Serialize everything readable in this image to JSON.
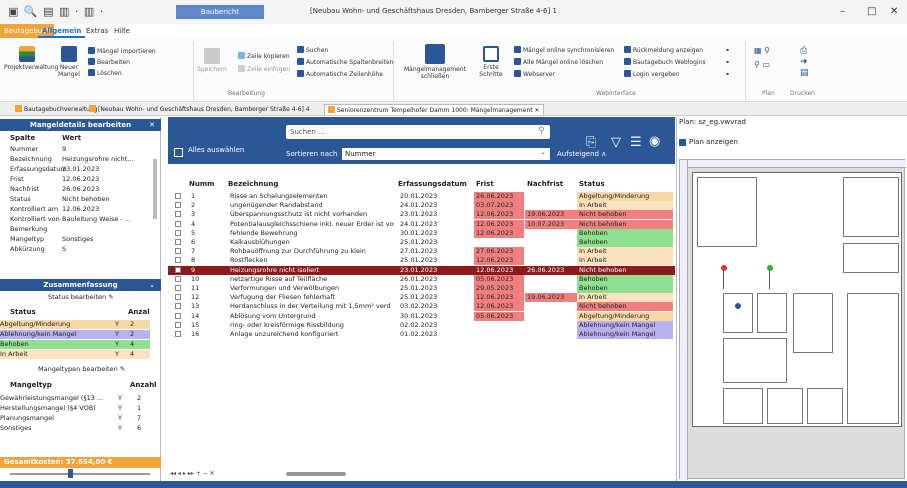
{
  "app": {
    "context_tab": "Baubericht",
    "window_title": "[Neubau Wohn- und Geschäftshaus Dresden, Bamberger Straße 4-6] 1",
    "window_controls": [
      "–",
      "□",
      "✕"
    ]
  },
  "ribbon_tabs": [
    "Bautagebuch",
    "Allgemein",
    "Extras",
    "Hilfe"
  ],
  "ribbon": {
    "projektverwaltung": "Projektverwaltung",
    "neuer_mangel": "Neuer Mangel",
    "maengel_importieren": "Mängel importieren",
    "bearbeiten": "Bearbeiten",
    "loeschen": "Löschen",
    "speichern": "Speichern",
    "zeile_kopieren": "Zeile kopieren",
    "zeile_einfuegen": "Zeile einfügen",
    "suchen": "Suchen",
    "auto_spaltenbreiten": "Automatische Spaltenbreiten",
    "auto_zeilenhoehe": "Automatische Zeilenhöhe",
    "group_bearbeitung": "Bearbeitung",
    "mangelmanagement": "Mängelmanagement schließen",
    "erste_schritte": "Erste Schritte",
    "sync": "Mängel online synchronisieren",
    "alle_loeschen": "Alle Mängel online löschen",
    "webserver": "Webserver",
    "rueckmeldung": "Rückmeldung anzeigen",
    "webpaket": "Bautagebuch Weblogins",
    "login_vergeben": "Login vergeben",
    "group_webinterface": "Webinterface",
    "group_plan": "Plan",
    "group_drucken": "Drucken"
  },
  "doc_tabs": [
    "Bautagebuchverwaltung",
    "[Neubau Wohn- und Geschäftshaus Dresden, Bamberger Straße 4-6] 4",
    "Seniorenzentrum Tempelhofer Damm 1000: Mängelmanagement"
  ],
  "details": {
    "title": "Mangeldetails bearbeiten",
    "col_spalte": "Spalte",
    "col_wert": "Wert",
    "rows": [
      [
        "Nummer",
        "9"
      ],
      [
        "Bezeichnung",
        "Heizungsrohre nicht..."
      ],
      [
        "Erfassungsdatum",
        "23.01.2023"
      ],
      [
        "Frist",
        "12.06.2023"
      ],
      [
        "Nachfrist",
        "26.06.2023"
      ],
      [
        "Status",
        "Nicht behoben"
      ],
      [
        "Kontrolliert am",
        "12.06.2023"
      ],
      [
        "Kontrolliert von",
        "Bauleitung Weise - ..."
      ],
      [
        "Bemerkung",
        ""
      ],
      [
        "Mangeltyp",
        "Sonstiges"
      ],
      [
        "Abkürzung",
        "S"
      ]
    ]
  },
  "summary": {
    "title": "Zusammenfassung",
    "status_bearbeiten": "Status bearbeiten",
    "col_status": "Status",
    "col_anzahl": "Anzal",
    "status_rows": [
      {
        "name": "Abgeltung/Minderung",
        "flag": "Y",
        "count": "2",
        "color": "#f7d9a8"
      },
      {
        "name": "Ablehnung/kein Mangel",
        "flag": "Y",
        "count": "2",
        "color": "#b9b0f0"
      },
      {
        "name": "Behoben",
        "flag": "Y",
        "count": "4",
        "color": "#8fe08f"
      },
      {
        "name": "In Arbeit",
        "flag": "Y",
        "count": "4",
        "color": "#fbe3c0"
      }
    ],
    "mangeltypen_bearbeiten": "Mangeltypen bearbeiten",
    "col_mangeltyp": "Mangeltyp",
    "col_anzahl2": "Anzahl",
    "type_rows": [
      {
        "name": "Gewährleistungsmangel (§13 ...",
        "flag": "Y",
        "count": "2"
      },
      {
        "name": "Herstellungsmangel (§4 VOB)",
        "flag": "Y",
        "count": "1"
      },
      {
        "name": "Planungsmangel",
        "flag": "Y",
        "count": "7"
      },
      {
        "name": "Sonstiges",
        "flag": "Y",
        "count": "6"
      }
    ],
    "gesamtkosten": "Gesamtkosten: 37.654,00 €"
  },
  "toolbar": {
    "search_placeholder": "Suchen ...",
    "alle_auswaehlen": "Alles auswählen",
    "sortieren_nach": "Sortieren nach",
    "sort_value": "Nummer",
    "aufsteigend": "Aufsteigend ∧"
  },
  "grid": {
    "headers": [
      "Numm",
      "Bezeichnung",
      "Erfassungsdatum",
      "Frist",
      "Nachfrist",
      "Status"
    ],
    "rows": [
      {
        "nr": "1",
        "bez": "Risse an Schalungselementen",
        "erf": "20.01.2023",
        "frist": "26.06.2023",
        "nach": "",
        "status": "Abgeltung/Minderung",
        "fc": "#f08080",
        "nc": "",
        "sc": "#f7d9a8"
      },
      {
        "nr": "2",
        "bez": "ungenügender Randabstand",
        "erf": "24.01.2023",
        "frist": "03.07.2023",
        "nach": "",
        "status": "In Arbeit",
        "fc": "#f08080",
        "nc": "",
        "sc": "#fbe3c0"
      },
      {
        "nr": "3",
        "bez": "Überspannungsschutz ist nicht vorhanden",
        "erf": "23.01.2023",
        "frist": "12.06.2023",
        "nach": "19.06.2023",
        "status": "Nicht behoben",
        "fc": "#f08080",
        "nc": "#f08080",
        "sc": "#f08080"
      },
      {
        "nr": "4",
        "bez": "Potentialausgleichsschiene inkl. neuer Erder ist vo",
        "erf": "24.01.2023",
        "frist": "12.06.2023",
        "nach": "10.07.2023",
        "status": "Nicht behoben",
        "fc": "#f08080",
        "nc": "#f08080",
        "sc": "#f08080"
      },
      {
        "nr": "5",
        "bez": "fehlende Bewehrung",
        "erf": "30.01.2023",
        "frist": "12.06.2023",
        "nach": "",
        "status": "Behoben",
        "fc": "#f08080",
        "nc": "",
        "sc": "#8fe08f"
      },
      {
        "nr": "6",
        "bez": "Kalkausblühungen",
        "erf": "25.01.2023",
        "frist": "",
        "nach": "",
        "status": "Behoben",
        "fc": "",
        "nc": "",
        "sc": "#8fe08f"
      },
      {
        "nr": "7",
        "bez": "Rohbauöffnung zur Durchführung zu klein",
        "erf": "27.01.2023",
        "frist": "27.06.2023",
        "nach": "",
        "status": "In Arbeit",
        "fc": "#f08080",
        "nc": "",
        "sc": "#fbe3c0"
      },
      {
        "nr": "8",
        "bez": "Rostflecken",
        "erf": "25.01.2023",
        "frist": "12.06.2023",
        "nach": "",
        "status": "In Arbeit",
        "fc": "#f08080",
        "nc": "",
        "sc": "#fbe3c0"
      },
      {
        "nr": "9",
        "bez": "Heizungsrohre nicht isoliert",
        "erf": "23.01.2023",
        "frist": "12.06.2023",
        "nach": "26.06.2023",
        "status": "Nicht behoben",
        "fc": "#8b1a1a",
        "nc": "#8b1a1a",
        "sc": "#8b1a1a",
        "selected": true
      },
      {
        "nr": "10",
        "bez": "netzartige Risse auf Teilfläche",
        "erf": "26.01.2023",
        "frist": "05.06.2023",
        "nach": "",
        "status": "Behoben",
        "fc": "#f08080",
        "nc": "",
        "sc": "#8fe08f"
      },
      {
        "nr": "11",
        "bez": "Verformungen und Verwölbungen",
        "erf": "25.01.2023",
        "frist": "29.05.2023",
        "nach": "",
        "status": "Behoben",
        "fc": "#f08080",
        "nc": "",
        "sc": "#8fe08f"
      },
      {
        "nr": "12",
        "bez": "Verfugung der Fliesen fehlerhaft",
        "erf": "25.01.2023",
        "frist": "12.06.2023",
        "nach": "19.06.2023",
        "status": "In Arbeit",
        "fc": "#f08080",
        "nc": "#f08080",
        "sc": "#fbe3c0"
      },
      {
        "nr": "13",
        "bez": "Herdanschluss in der Verteilung mit 1,5mm² verd",
        "erf": "03.02.2023",
        "frist": "12.06.2023",
        "nach": "",
        "status": "Nicht behoben",
        "fc": "#f08080",
        "nc": "",
        "sc": "#f08080"
      },
      {
        "nr": "14",
        "bez": "Ablösung vom Untergrund",
        "erf": "30.01.2023",
        "frist": "05.06.2023",
        "nach": "",
        "status": "Abgeltung/Minderung",
        "fc": "#f08080",
        "nc": "",
        "sc": "#f7d9a8"
      },
      {
        "nr": "15",
        "bez": "ring- oder kreisförmige Rissbildung",
        "erf": "02.02.2023",
        "frist": "",
        "nach": "",
        "status": "Ablehnung/kein Mangel",
        "fc": "",
        "nc": "",
        "sc": "#b9b0f0"
      },
      {
        "nr": "16",
        "bez": "Anlage unzureichend konfiguriert",
        "erf": "01.02.2023",
        "frist": "",
        "nach": "",
        "status": "Ablehnung/kein Mangel",
        "fc": "",
        "nc": "",
        "sc": "#b9b0f0"
      }
    ]
  },
  "plan": {
    "title": "Plan: sz_eg.vwvrad",
    "plan_anzeigen": "Plan anzeigen"
  },
  "pager": "◂◂ ◂ ▸ ▸▸ + − ✕",
  "colors": {
    "accent": "#2b5797",
    "orange": "#f2a33a",
    "selected": "#8b1a1a"
  }
}
